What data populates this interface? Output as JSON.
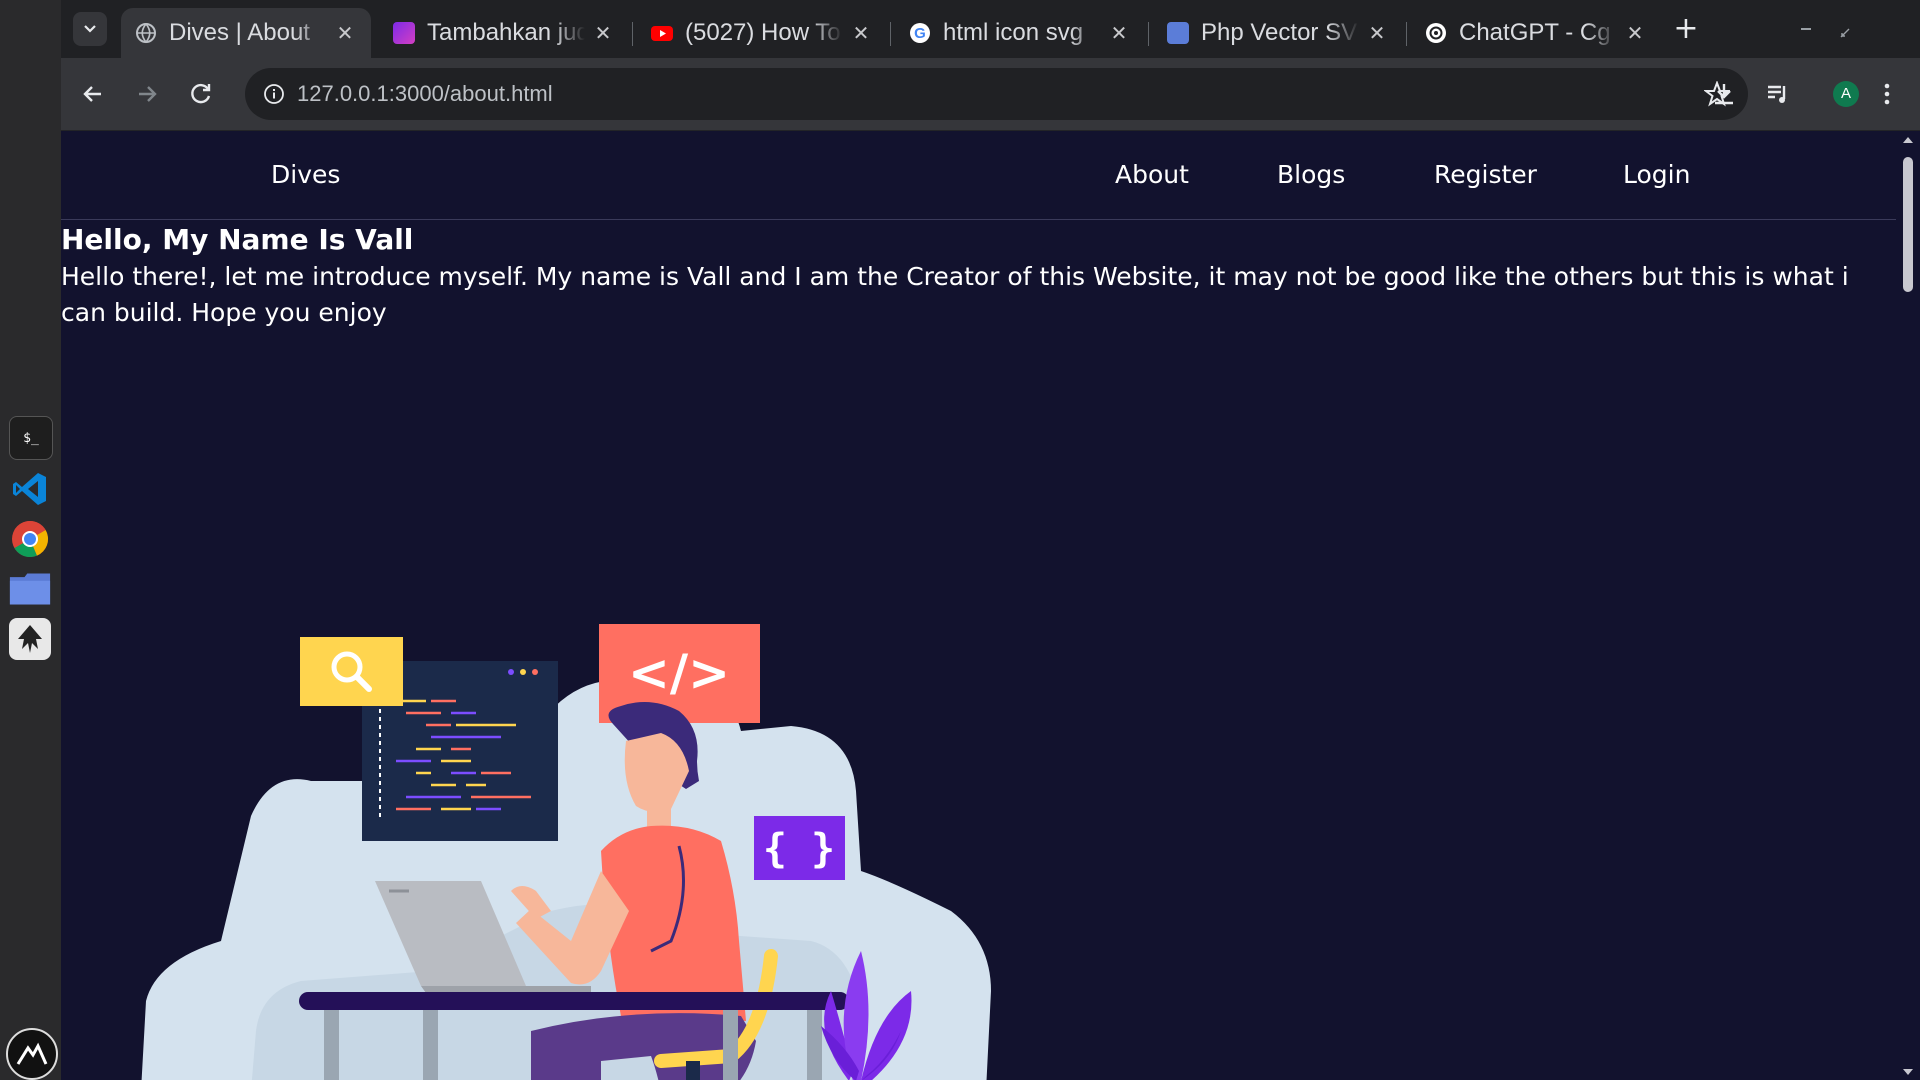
{
  "browser": {
    "tabs": [
      {
        "title": "Dives | About",
        "favicon": "globe-icon",
        "active": true
      },
      {
        "title": "Tambahkan judul",
        "favicon": "canva-icon",
        "active": false
      },
      {
        "title": "(5027) How To",
        "favicon": "youtube-icon",
        "active": false
      },
      {
        "title": "html icon svg",
        "favicon": "google-icon",
        "active": false
      },
      {
        "title": "Php Vector SVG",
        "favicon": "svgrepo-icon",
        "active": false
      },
      {
        "title": "ChatGPT - Cg",
        "favicon": "openai-icon",
        "active": false
      }
    ],
    "url": "127.0.0.1:3000/about.html",
    "profile_initial": "A",
    "accent": "#1a73e8"
  },
  "dock": {
    "terminal_label": "$_",
    "apps": [
      "terminal-icon",
      "vscode-icon",
      "chrome-icon",
      "files-icon",
      "inkscape-icon",
      "launcher-icon"
    ]
  },
  "page": {
    "nav": {
      "brand": "Dives",
      "links": [
        "About",
        "Blogs",
        "Register",
        "Login"
      ]
    },
    "heading": "Hello, My Name Is Vall",
    "intro": "Hello there!, let me introduce myself. My name is Vall and I am the Creator of this Website, it may not be good like the others but this is what i can build. Hope you enjoy",
    "background_color": "#12122e",
    "illustration": {
      "code_tag": "</>",
      "braces": "{ }"
    }
  }
}
